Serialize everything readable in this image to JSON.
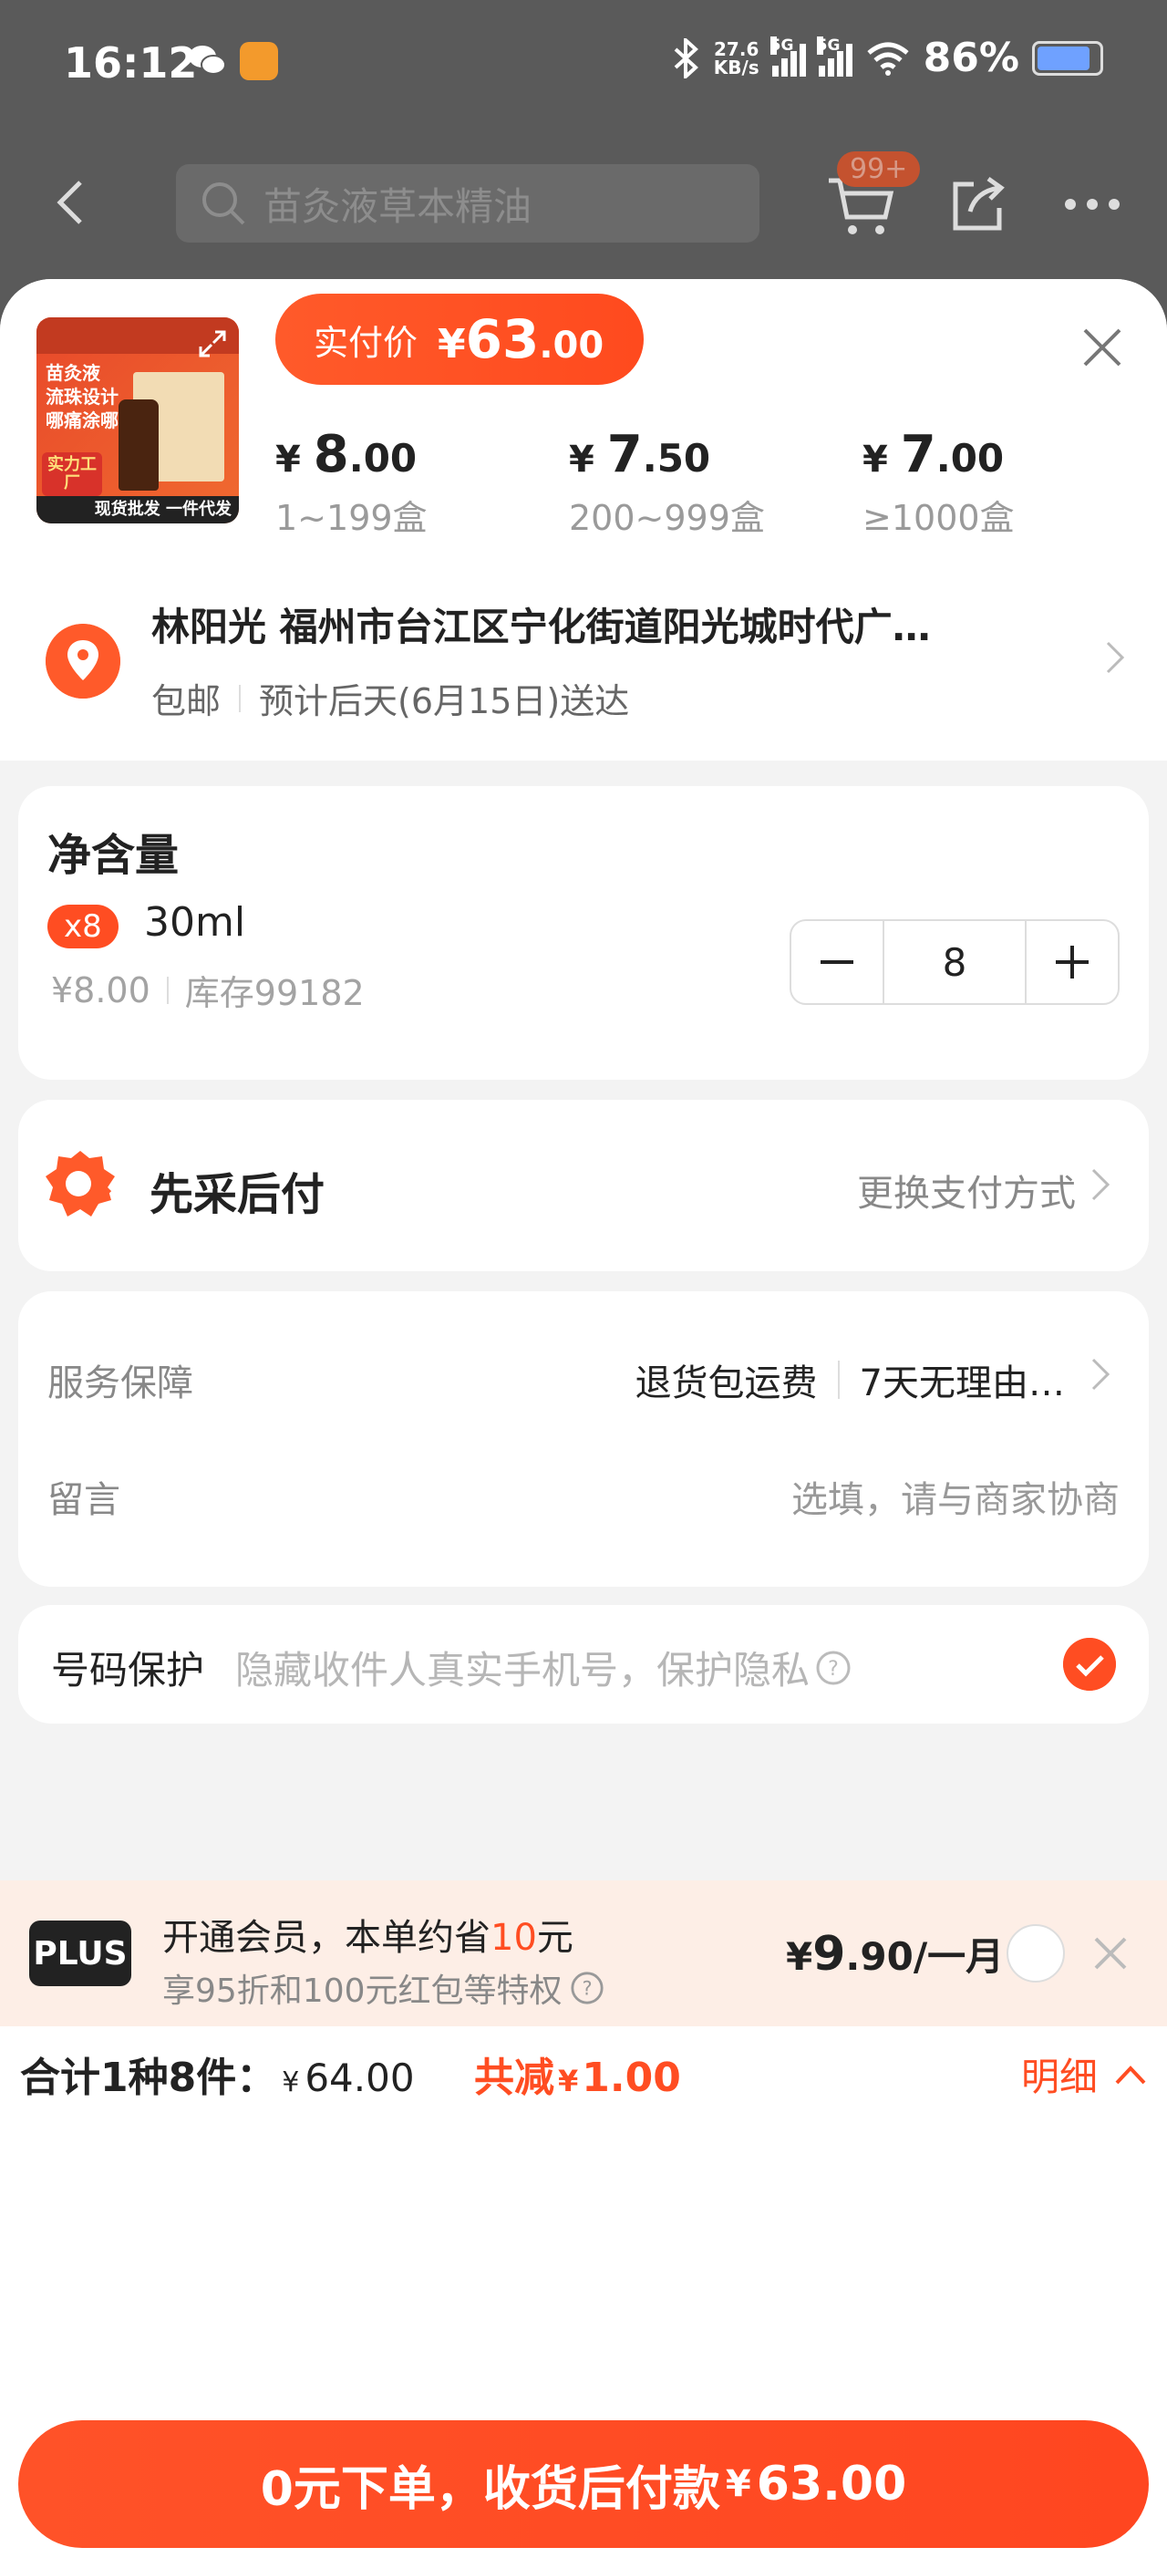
{
  "status_bar": {
    "time": "16:12",
    "speed_top": "27.6",
    "speed_bottom": "KB/s",
    "net1": "5G",
    "net2": "5G",
    "battery": "86%"
  },
  "nav": {
    "search_placeholder": "苗灸液草本精油",
    "cart_badge": "99+"
  },
  "product": {
    "thumb_text": "苗灸液 流珠设计 哪痛涂哪",
    "thumb_badge": "实力工厂",
    "thumb_foot": "现货批发 一件代发",
    "paid_label": "实付价",
    "paid_yen": "¥",
    "paid_int": "63",
    "paid_dec": ".00",
    "tiers": [
      {
        "yen": "¥ ",
        "int": "8",
        "dec": ".00",
        "range": "1~199盒"
      },
      {
        "yen": "¥ ",
        "int": "7",
        "dec": ".50",
        "range": "200~999盒"
      },
      {
        "yen": "¥ ",
        "int": "7",
        "dec": ".00",
        "range": "≥1000盒"
      }
    ]
  },
  "address": {
    "name_line": "林阳光 福州市台江区宁化街道阳光城时代广…",
    "shipping": "包邮",
    "eta": "预计后天(6月15日)送达"
  },
  "spec": {
    "title": "净含量",
    "tag": "x8",
    "option": "30ml",
    "price": "¥8.00",
    "stock": "库存99182",
    "quantity": "8"
  },
  "payment": {
    "label": "先采后付",
    "change": "更换支付方式"
  },
  "service": {
    "label": "服务保障",
    "item1": "退货包运费",
    "item2": "7天无理由…",
    "message_label": "留言",
    "message_placeholder": "选填，请与商家协商"
  },
  "privacy": {
    "label": "号码保护",
    "hint": "隐藏收件人真实手机号，保护隐私"
  },
  "plus": {
    "logo": "PLUS",
    "line1_a": "开通会员，本单约省",
    "line1_hl": "10",
    "line1_b": "元",
    "line2": "享95折和100元红包等特权",
    "price_yen": "¥",
    "price_int": "9",
    "price_rest": ".90/一月"
  },
  "totals": {
    "summary": "合计1种8件：",
    "yen": "¥",
    "amount": "64.00",
    "save_label": "共减",
    "save_yen": "¥",
    "save_amount": "1.00",
    "detail": "明细"
  },
  "cta": {
    "label": "0元下单，收货后付款",
    "yen": "¥",
    "amount": "63.00"
  },
  "colors": {
    "accent": "#ff4d22",
    "sheet_bg": "#f3f3f3",
    "plus_bg": "#fdeee6"
  }
}
